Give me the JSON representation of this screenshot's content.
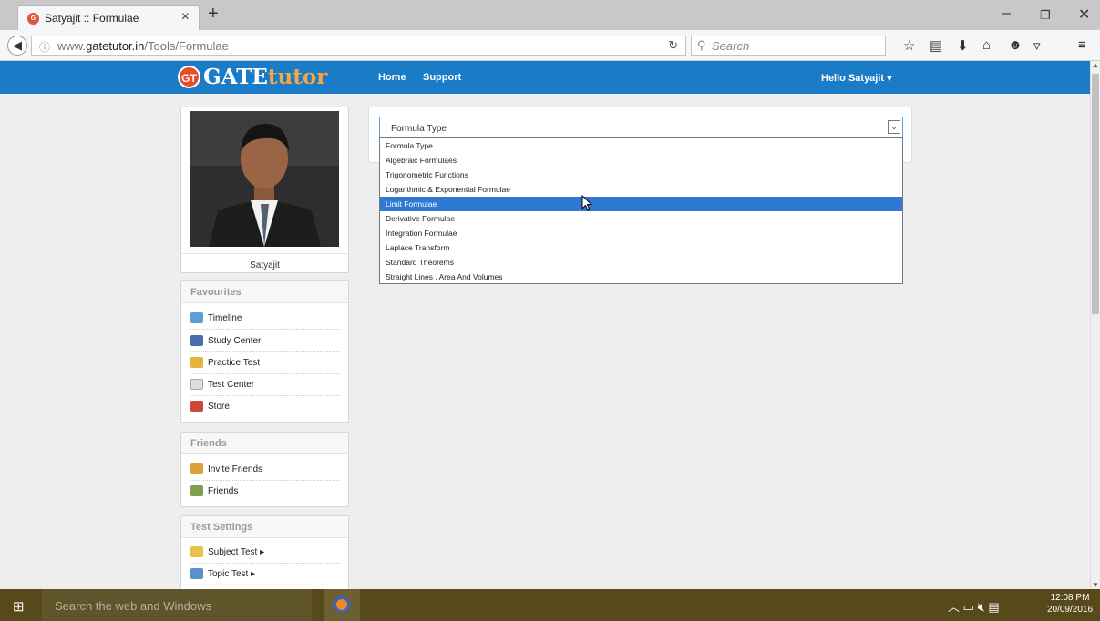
{
  "browser": {
    "tab_title": "Satyajit :: Formulae",
    "url_prefix": "www.",
    "url_domain": "gatetutor.in",
    "url_path": "/Tools/Formulae",
    "search_placeholder": "Search"
  },
  "site": {
    "logo_badge": "GT",
    "logo_part1": "GATE",
    "logo_part2": "tutor",
    "nav": [
      "Home",
      "Support"
    ],
    "user_menu": "Hello Satyajit ▾"
  },
  "profile": {
    "name": "Satyajit"
  },
  "favourites": {
    "title": "Favourites",
    "items": [
      "Timeline",
      "Study Center",
      "Practice Test",
      "Test Center",
      "Store"
    ]
  },
  "friends": {
    "title": "Friends",
    "items": [
      "Invite Friends",
      "Friends"
    ]
  },
  "test_settings": {
    "title": "Test Settings",
    "items": [
      "Subject Test ▸",
      "Topic Test ▸"
    ]
  },
  "formula_select": {
    "value": "Formula Type",
    "options": [
      "Formula Type",
      "Algebraic Formulaes",
      "Trigonometric Functions",
      "Logarithmic & Exponential Formulae",
      "Limit Formulae",
      "Derivative Formulae",
      "Integration Formulae",
      "Laplace Transform",
      "Standard Theorems",
      "Straight Lines , Area And Volumes"
    ],
    "highlighted": "Limit Formulae"
  },
  "taskbar": {
    "search_placeholder": "Search the web and Windows",
    "time": "12:08 PM",
    "date": "20/09/2016"
  },
  "colors": {
    "header_blue": "#1a7bc6",
    "highlight": "#2f78d3",
    "taskbar": "#574919"
  }
}
